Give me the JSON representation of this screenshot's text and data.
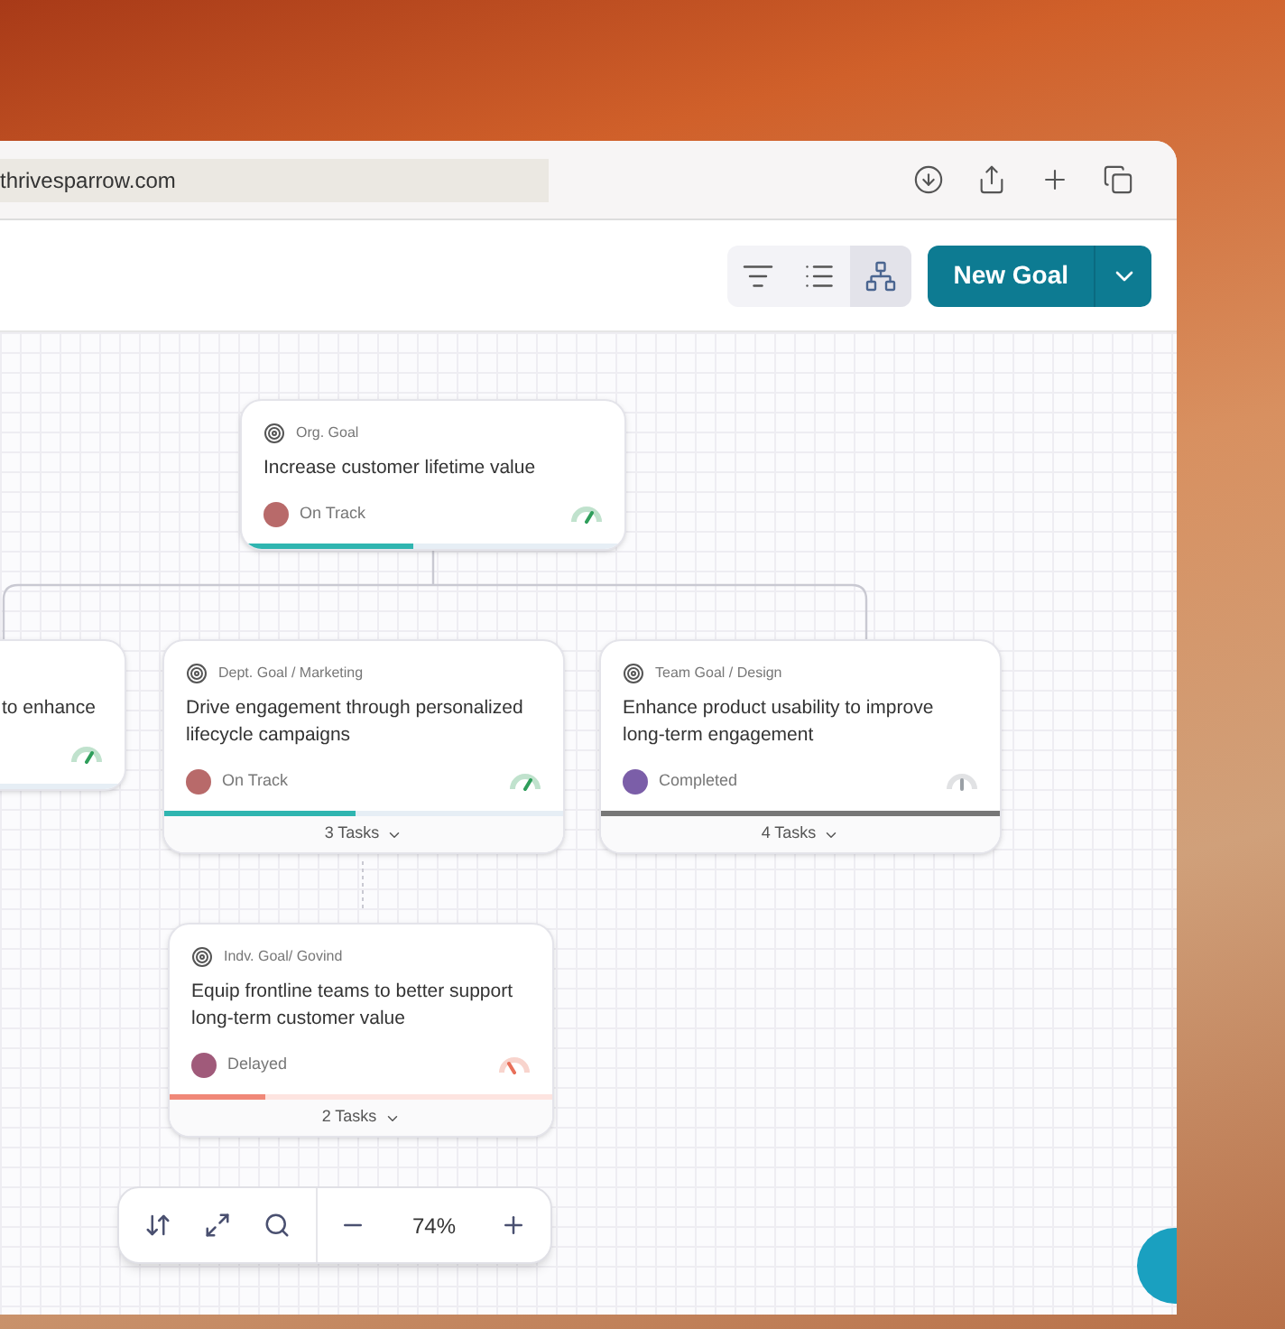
{
  "browser": {
    "address": "thrivesparrow.com"
  },
  "toolbar": {
    "views": [
      {
        "kind": "tiers",
        "selected": false
      },
      {
        "kind": "list",
        "selected": false
      },
      {
        "kind": "org-chart",
        "selected": true
      }
    ],
    "new_goal": "New Goal"
  },
  "goals": [
    {
      "category": "Org. Goal",
      "title": "Increase customer lifetime value",
      "status": "On Track",
      "kind": "on_track",
      "level": 0.45
    },
    {
      "title": "to enhance",
      "kind": "on_track"
    },
    {
      "category": "Dept. Goal / Marketing",
      "title": "Drive engagement through personalized lifecycle campaigns",
      "status": "On Track",
      "kind": "on_track",
      "level": 0.48,
      "tasks": "3 Tasks"
    },
    {
      "category": "Team Goal / Design",
      "title": "Enhance product usability to improve long-term engagement",
      "status": "Completed",
      "kind": "completed",
      "level": 1,
      "tasks": "4 Tasks"
    },
    {
      "category": "Indv. Goal/ Govind",
      "title": "Equip frontline teams to better support long-term customer value",
      "status": "Delayed",
      "kind": "delayed",
      "level": 0.25,
      "tasks": "2 Tasks"
    }
  ],
  "zoom": {
    "value": "74%"
  }
}
